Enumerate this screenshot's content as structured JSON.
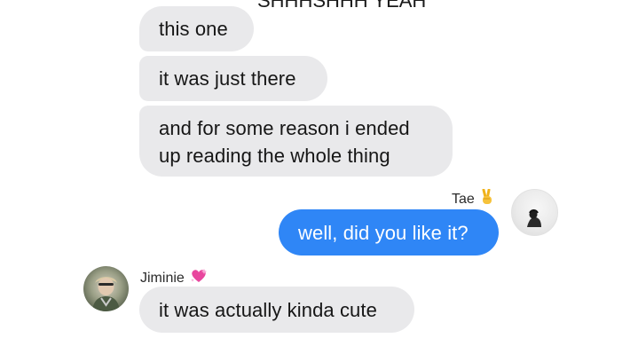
{
  "thread": {
    "cut_top_text": "SHHHSHHH YEAH",
    "messages": [
      {
        "sender": "other",
        "text": "this one"
      },
      {
        "sender": "other",
        "text": "it was just there"
      },
      {
        "sender": "other",
        "text": "and for some reason i ended up reading the whole thing"
      },
      {
        "sender": "Tae",
        "text": "well, did you like it?"
      },
      {
        "sender": "Jiminie",
        "text": "it was actually kinda cute"
      }
    ]
  },
  "participants": {
    "tae": {
      "name": "Tae",
      "emoji_icon": "victory-hand-icon"
    },
    "jiminie": {
      "name": "Jiminie",
      "emoji_icon": "sparkling-heart-icon"
    }
  },
  "colors": {
    "incoming_bubble": "#e9e9eb",
    "outgoing_bubble": "#2f86f6",
    "outgoing_text": "#ffffff"
  }
}
